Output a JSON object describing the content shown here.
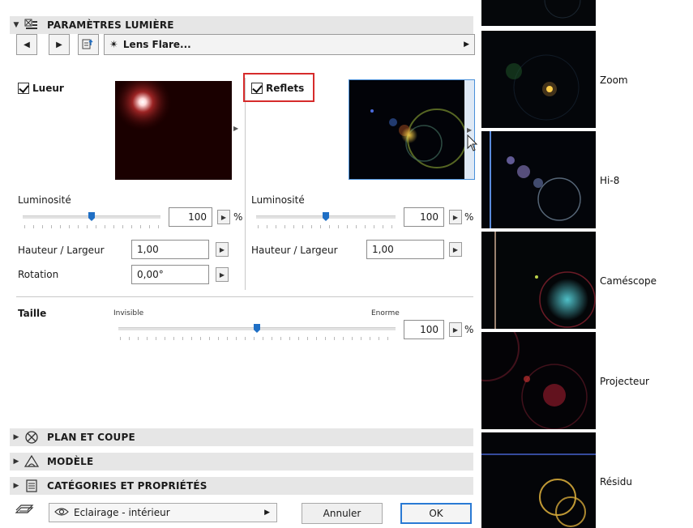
{
  "panel": {
    "title": "PARAMÈTRES LUMIÈRE",
    "effect_label": "Lens Flare...",
    "glow": {
      "checkbox_label": "Lueur",
      "brightness_label": "Luminosité",
      "brightness_value": "100",
      "brightness_unit": "%",
      "brightness_level": 0.5,
      "height_width_label": "Hauteur / Largeur",
      "height_width_value": "1,00",
      "rotation_label": "Rotation",
      "rotation_value": "0,00°"
    },
    "reflections": {
      "checkbox_label": "Reflets",
      "brightness_label": "Luminosité",
      "brightness_value": "100",
      "brightness_unit": "%",
      "brightness_level": 0.5,
      "height_width_label": "Hauteur / Largeur",
      "height_width_value": "1,00"
    },
    "size": {
      "label": "Taille",
      "min_label": "Invisible",
      "max_label": "Enorme",
      "value": "100",
      "unit": "%",
      "level": 0.5
    }
  },
  "sections": [
    {
      "label": "PLAN ET COUPE",
      "icon": "crossed-circle-icon"
    },
    {
      "label": "MODÈLE",
      "icon": "lamp-icon"
    },
    {
      "label": "CATÉGORIES ET PROPRIÉTÉS",
      "icon": "document-icon"
    }
  ],
  "footer": {
    "favorite_label": "Eclairage - intérieur",
    "cancel_label": "Annuler",
    "ok_label": "OK"
  },
  "presets": [
    {
      "label": "Zoom"
    },
    {
      "label": "Hi-8"
    },
    {
      "label": "Caméscope"
    },
    {
      "label": "Projecteur"
    },
    {
      "label": "Résidu"
    }
  ],
  "colors": {
    "accent": "#1f6fc5",
    "highlight_box": "#d62b2b",
    "section_bg": "#e6e6e6"
  }
}
